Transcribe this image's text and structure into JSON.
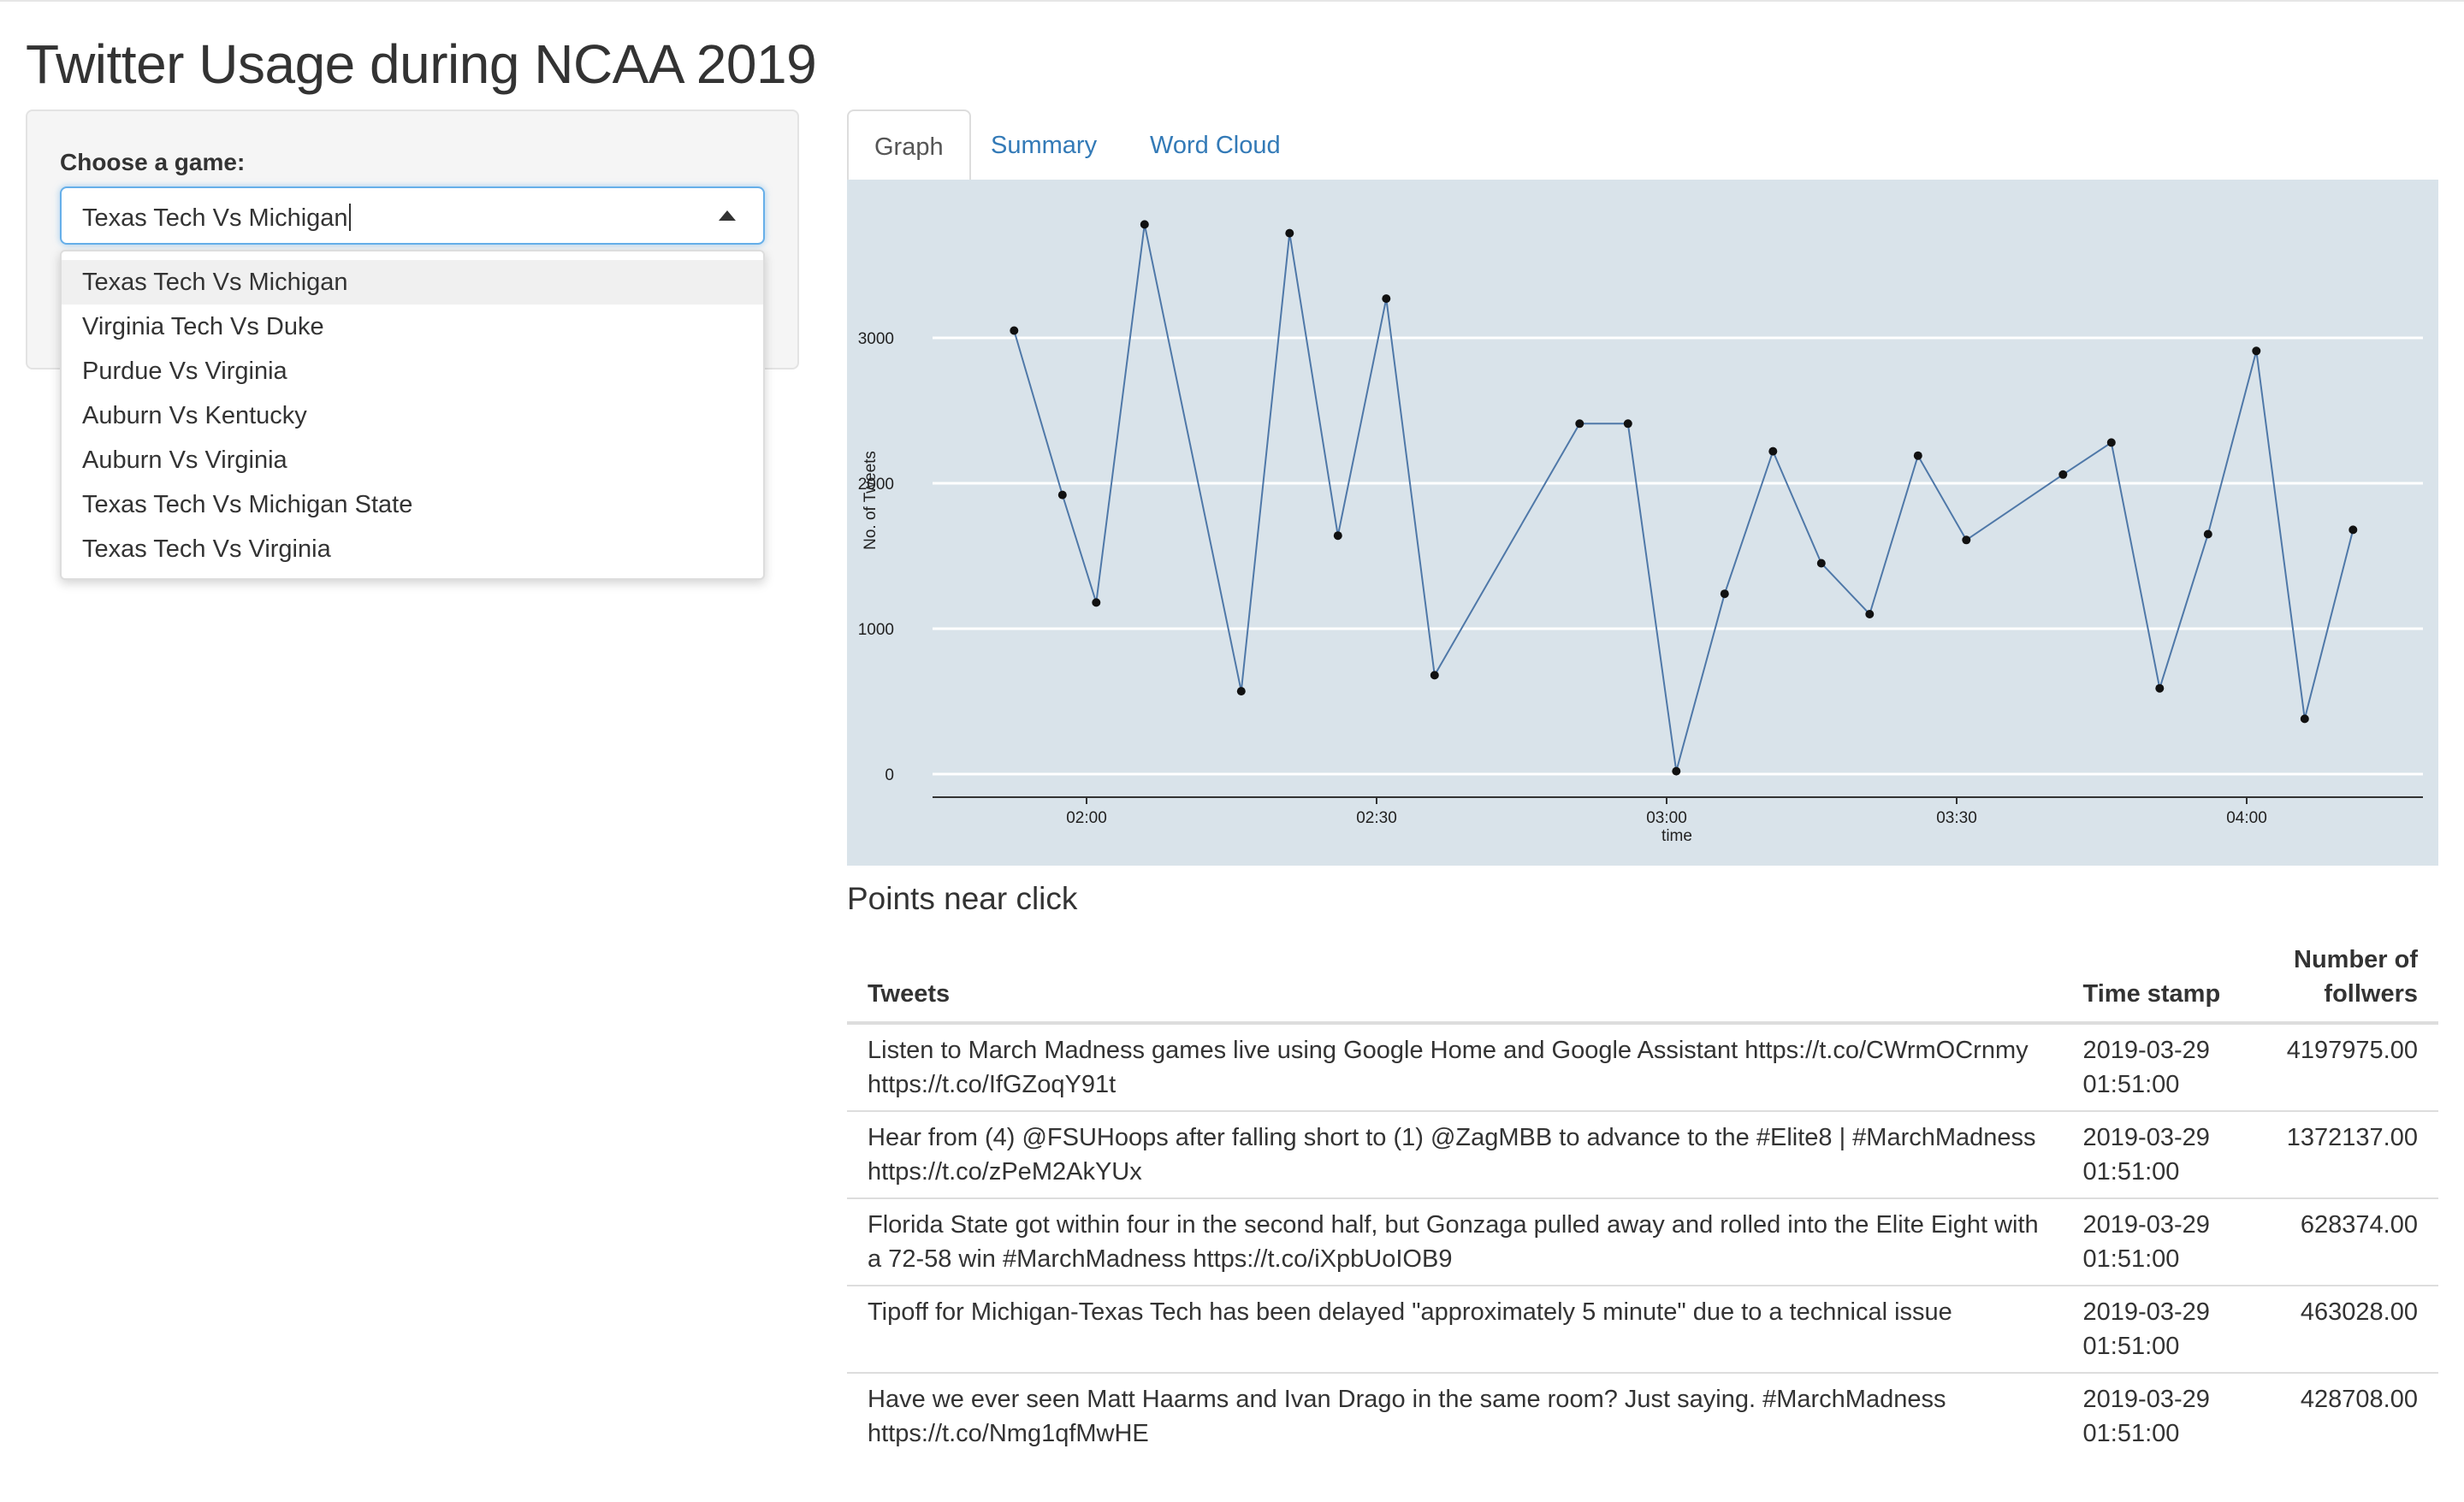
{
  "page": {
    "title": "Twitter Usage during NCAA 2019"
  },
  "sidebar": {
    "choose_label": "Choose a game:",
    "selected_value": "Texas Tech Vs Michigan",
    "options": [
      "Texas Tech Vs Michigan",
      "Virginia Tech Vs Duke",
      "Purdue Vs Virginia",
      "Auburn Vs Kentucky",
      "Auburn Vs Virginia",
      "Texas Tech Vs Michigan State",
      "Texas Tech Vs Virginia"
    ]
  },
  "tabs": [
    {
      "label": "Graph",
      "active": true
    },
    {
      "label": "Summary",
      "active": false
    },
    {
      "label": "Word Cloud",
      "active": false
    }
  ],
  "chart_data": {
    "type": "line",
    "xlabel": "time",
    "ylabel": "No. of Tweets",
    "x_ticks": [
      "02:00",
      "02:30",
      "03:00",
      "03:30",
      "04:00"
    ],
    "y_ticks": [
      0,
      1000,
      2000,
      3000
    ],
    "ylim": [
      0,
      3800
    ],
    "series": [
      {
        "color": "#4f78a8",
        "points": [
          {
            "x": "01:52:30",
            "y": 3050
          },
          {
            "x": "01:57:30",
            "y": 1920
          },
          {
            "x": "02:01:00",
            "y": 1180
          },
          {
            "x": "02:06:00",
            "y": 3780
          },
          {
            "x": "02:16:00",
            "y": 570
          },
          {
            "x": "02:21:00",
            "y": 3720
          },
          {
            "x": "02:26:00",
            "y": 1640
          },
          {
            "x": "02:31:00",
            "y": 3270
          },
          {
            "x": "02:36:00",
            "y": 680
          },
          {
            "x": "02:51:00",
            "y": 2410
          },
          {
            "x": "02:56:00",
            "y": 2410
          },
          {
            "x": "03:01:00",
            "y": 20
          },
          {
            "x": "03:06:00",
            "y": 1240
          },
          {
            "x": "03:11:00",
            "y": 2220
          },
          {
            "x": "03:16:00",
            "y": 1450
          },
          {
            "x": "03:21:00",
            "y": 1100
          },
          {
            "x": "03:26:00",
            "y": 2190
          },
          {
            "x": "03:31:00",
            "y": 1610
          },
          {
            "x": "03:41:00",
            "y": 2060
          },
          {
            "x": "03:46:00",
            "y": 2280
          },
          {
            "x": "03:51:00",
            "y": 590
          },
          {
            "x": "03:56:00",
            "y": 1650
          },
          {
            "x": "04:01:00",
            "y": 2910
          },
          {
            "x": "04:06:00",
            "y": 380
          },
          {
            "x": "04:11:00",
            "y": 1680
          }
        ]
      }
    ]
  },
  "points_near_click": {
    "title": "Points near click",
    "columns": [
      "Tweets",
      "Time stamp",
      "Number of follwers"
    ],
    "rows": [
      {
        "tweet": "Listen to March Madness games live using Google Home and Google Assistant https://t.co/CWrmOCrnmy https://t.co/IfGZoqY91t",
        "time": "2019-03-29 01:51:00",
        "followers": "4197975.00"
      },
      {
        "tweet": "Hear from (4) @FSUHoops after falling short to (1) @ZagMBB to advance to the #Elite8 | #MarchMadness https://t.co/zPeM2AkYUx",
        "time": "2019-03-29 01:51:00",
        "followers": "1372137.00"
      },
      {
        "tweet": "Florida State got within four in the second half, but Gonzaga pulled away and rolled into the Elite Eight with a 72-58 win #MarchMadness https://t.co/iXpbUoIOB9",
        "time": "2019-03-29 01:51:00",
        "followers": "628374.00"
      },
      {
        "tweet": "Tipoff for Michigan-Texas Tech has been delayed \"approximately 5 minute\" due to a technical issue",
        "time": "2019-03-29 01:51:00",
        "followers": "463028.00"
      },
      {
        "tweet": "Have we ever seen Matt Haarms and Ivan Drago in the same room? Just saying. #MarchMadness https://t.co/Nmg1qfMwHE",
        "time": "2019-03-29 01:51:00",
        "followers": "428708.00"
      }
    ]
  }
}
